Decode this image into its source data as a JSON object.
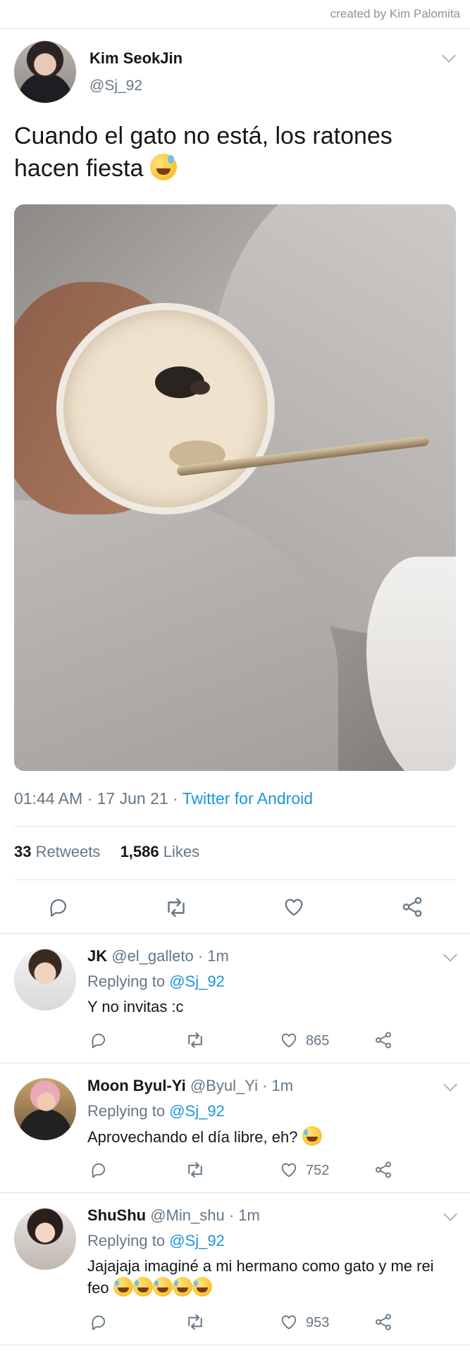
{
  "credit": "created by Kim Palomita",
  "tweet": {
    "author_name": "Kim SeokJin",
    "author_handle": "@Sj_92",
    "text": "Cuando el gato no está, los ratones hacen fiesta",
    "time": "01:44 AM · 17 Jun 21 · ",
    "source": "Twitter for Android",
    "retweets_count": "33",
    "retweets_label": " Retweets",
    "likes_count": "1,586",
    "likes_label": " Likes"
  },
  "replies": [
    {
      "name": "JK",
      "handle": " @el_galleto · 1m",
      "replying_label": "Replying to ",
      "replying_to": "@Sj_92",
      "text": "Y no invitas :c",
      "likes": "865"
    },
    {
      "name": "Moon Byul-Yi",
      "handle": " @Byul_Yi · 1m",
      "replying_label": "Replying to ",
      "replying_to": "@Sj_92",
      "text": "Aprovechando el día libre, eh?",
      "likes": "752"
    },
    {
      "name": "ShuShu",
      "handle": " @Min_shu · 1m",
      "replying_label": "Replying to ",
      "replying_to": "@Sj_92",
      "text": "Jajajaja imaginé a mi hermano como gato y me rei feo",
      "likes": "953"
    }
  ],
  "icons": [
    "chevron-down-icon",
    "reply-icon",
    "retweet-icon",
    "like-icon",
    "share-icon",
    "grinning-sweat-emoji",
    "rofl-emoji"
  ],
  "colors": {
    "link": "#1b95e0",
    "secondary": "#657786",
    "text": "#14171a",
    "divider": "#dfe3e6"
  }
}
